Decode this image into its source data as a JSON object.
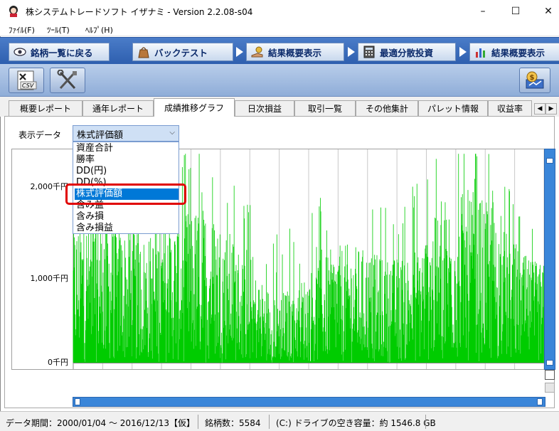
{
  "window": {
    "title": "株システムトレードソフト イザナミ - Version 2.2.08-s04",
    "minimize": "–",
    "maximize": "☐",
    "close": "✕"
  },
  "menu": [
    {
      "label": "ﾌｧｲﾙ(F)"
    },
    {
      "label": "ﾂｰﾙ(T)"
    },
    {
      "label": "ﾍﾙﾌﾟ(H)"
    }
  ],
  "nav": [
    {
      "label": "銘柄一覧に戻る",
      "icon": "eye-icon"
    },
    {
      "label": "バックテスト",
      "icon": "bag-icon"
    },
    {
      "label": "結果概要表示",
      "icon": "money-hand-icon"
    },
    {
      "label": "最適分散投資",
      "icon": "calculator-icon"
    },
    {
      "label": "結果概要表示",
      "icon": "bar-chart-icon"
    }
  ],
  "toolbar": {
    "csv_label": "CSV"
  },
  "tabs": [
    {
      "label": "概要レポート",
      "active": false
    },
    {
      "label": "通年レポート",
      "active": false
    },
    {
      "label": "成績推移グラフ",
      "active": true
    },
    {
      "label": "日次損益",
      "active": false
    },
    {
      "label": "取引一覧",
      "active": false
    },
    {
      "label": "その他集計",
      "active": false
    },
    {
      "label": "パレット情報",
      "active": false
    },
    {
      "label": "収益率",
      "active": false
    }
  ],
  "display_data": {
    "label": "表示データ",
    "selected": "株式評価額",
    "options": [
      "資産合計",
      "勝率",
      "DD(円)",
      "DD(%)",
      "株式評価額",
      "含み益",
      "含み損",
      "含み損益"
    ]
  },
  "chart_data": {
    "type": "bar",
    "series_color": "#00cc00",
    "ytick_labels": [
      "2,000千円",
      "1,000千円",
      "0千円"
    ],
    "ylim": [
      0,
      2400
    ],
    "grid": true,
    "points": 1200,
    "note_values": "dense daily bars oscillating roughly between 0 and 2,300千円"
  },
  "status": {
    "period": "データ期間：2000/01/04 〜 2016/12/13【仮】",
    "count": "銘柄数：5584",
    "drive": "(C:) ドライブの空き容量：約 1546.8 GB"
  }
}
